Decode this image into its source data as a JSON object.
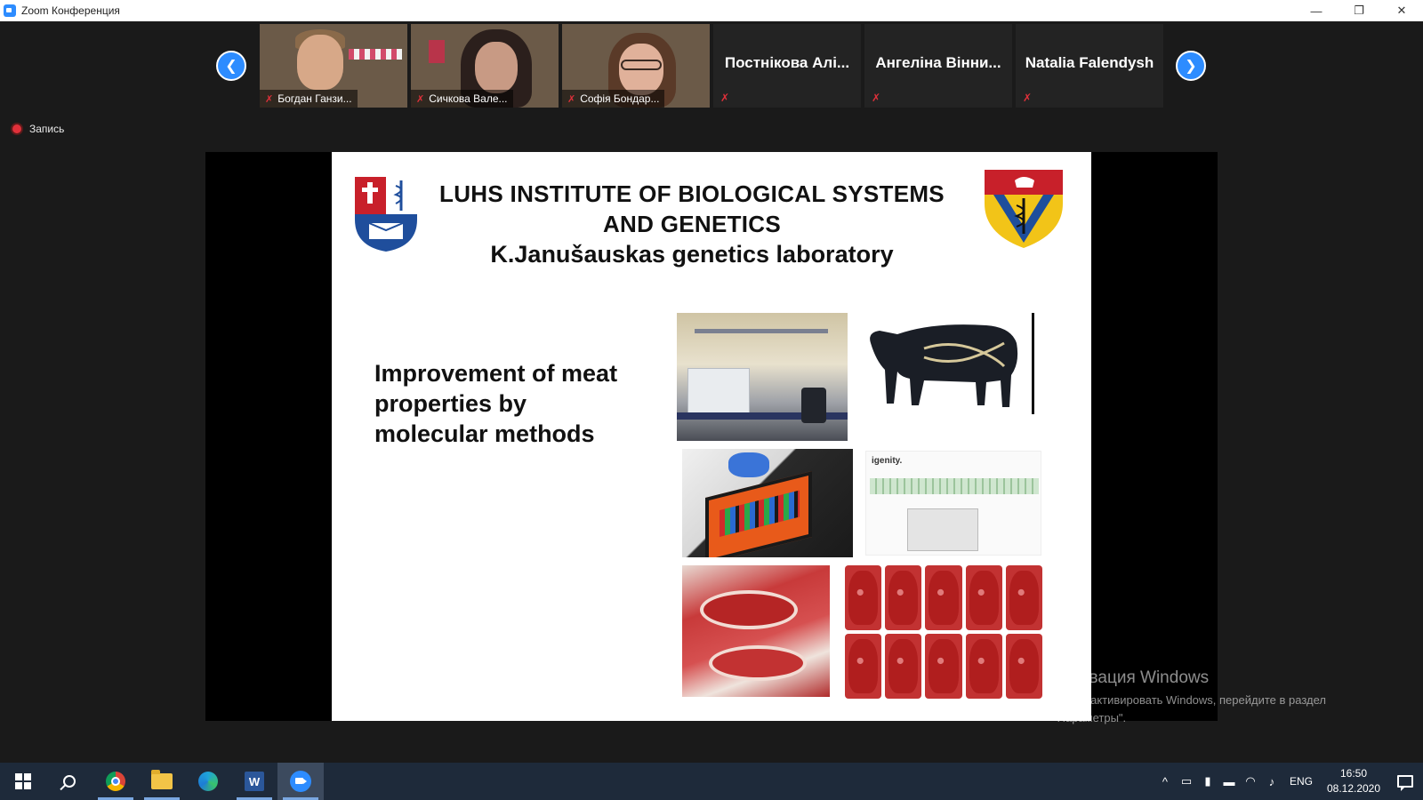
{
  "window": {
    "title": "Zoom Конференция",
    "minimize_glyph": "—",
    "restore_glyph": "❐",
    "close_glyph": "✕"
  },
  "gallery": {
    "prev_glyph": "❮",
    "next_glyph": "❯",
    "participants": [
      {
        "name": "Богдан Ганзи...",
        "video": true,
        "muted": true
      },
      {
        "name": "Сичкова Вале...",
        "video": true,
        "muted": true
      },
      {
        "name": "Софія Бондар...",
        "video": true,
        "muted": true
      },
      {
        "name": "Постнікова Алі...",
        "video": false,
        "muted": true
      },
      {
        "name": "Ангеліна Вінни...",
        "video": false,
        "muted": true
      },
      {
        "name": "Natalia Falendysh",
        "video": false,
        "muted": true
      }
    ],
    "mic_off_glyph": "✗"
  },
  "recording": {
    "label": "Запись"
  },
  "slide": {
    "title_line1": "LUHS INSTITUTE OF BIOLOGICAL  SYSTEMS",
    "title_line2": "AND GENETICS",
    "subtitle": "K.Janušauskas genetics laboratory",
    "body": "Improvement of meat properties by molecular methods",
    "igenity_label": "igenity."
  },
  "watermark": {
    "title": "Активация Windows",
    "line1": "Чтобы активировать Windows, перейдите в раздел",
    "line2": "\"Параметры\"."
  },
  "taskbar": {
    "word_letter": "W",
    "tray_chevron": "^",
    "language": "ENG",
    "time": "16:50",
    "date": "08.12.2020"
  },
  "colors": {
    "accent": "#2d8cff",
    "muted_red": "#e0303a",
    "taskbar": "#1e2a3a"
  }
}
